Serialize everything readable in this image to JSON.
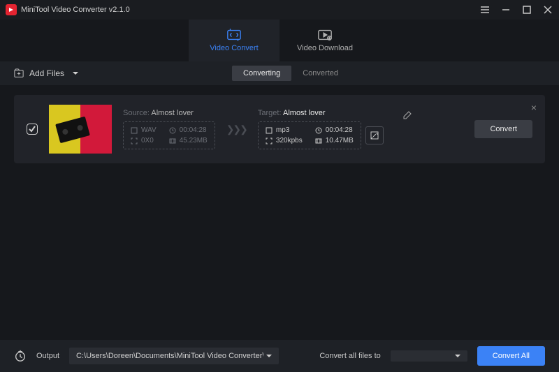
{
  "app": {
    "title": "MiniTool Video Converter v2.1.0"
  },
  "tabs": {
    "convert": "Video Convert",
    "download": "Video Download"
  },
  "toolbar": {
    "add_files": "Add Files",
    "status_converting": "Converting",
    "status_converted": "Converted"
  },
  "item": {
    "source_label": "Source:",
    "source_name": "Almost lover",
    "source_format": "WAV",
    "source_duration": "00:04:28",
    "source_resolution": "0X0",
    "source_size": "45.23MB",
    "target_label": "Target:",
    "target_name": "Almost lover",
    "target_format": "mp3",
    "target_duration": "00:04:28",
    "target_bitrate": "320kpbs",
    "target_size": "10.47MB",
    "convert_btn": "Convert"
  },
  "footer": {
    "output_label": "Output",
    "output_path": "C:\\Users\\Doreen\\Documents\\MiniTool Video Converter\\outpu",
    "convert_all_to": "Convert all files to",
    "convert_all_btn": "Convert All"
  },
  "colors": {
    "accent": "#3b82f6",
    "brand": "#e52431"
  }
}
